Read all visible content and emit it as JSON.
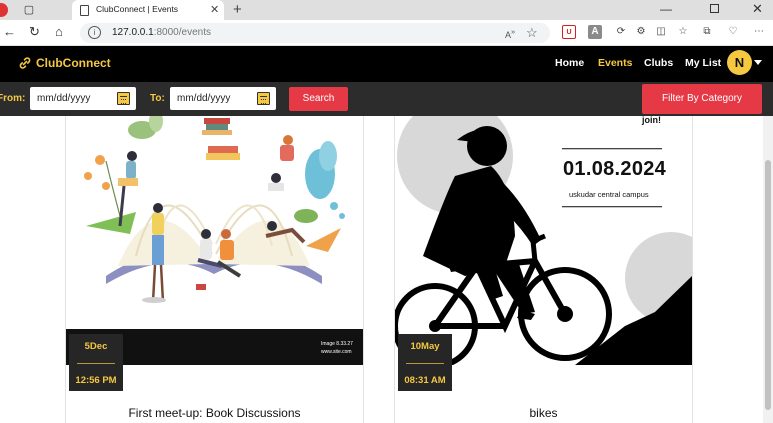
{
  "browser": {
    "tab_title": "ClubConnect | Events",
    "url_host": "127.0.0.1",
    "url_path": ":8000/events"
  },
  "navbar": {
    "brand": "ClubConnect",
    "links": [
      {
        "label": "Home",
        "active": false
      },
      {
        "label": "Events",
        "active": true
      },
      {
        "label": "Clubs",
        "active": false
      },
      {
        "label": "My List",
        "active": false
      }
    ],
    "avatar_initial": "N"
  },
  "filter": {
    "from_label": "From:",
    "from_value": "mm/dd/yyyy",
    "to_label": "To:",
    "to_value": "mm/dd/yyyy",
    "search_label": "Search",
    "category_label": "Filter By Category"
  },
  "events": [
    {
      "title": "First meet-up: Book Discussions",
      "day": "5Dec",
      "time": "12:56 PM",
      "image_caption_1": "Image 8.33.27",
      "image_caption_2": "www.site.com"
    },
    {
      "title": "bikes",
      "day": "10May",
      "time": "08:31 AM",
      "poster_join": "join!",
      "poster_date": "01.08.2024",
      "poster_place": "uskudar central campus"
    }
  ],
  "colors": {
    "accent_yellow": "#f5c842",
    "accent_red": "#e63946",
    "navbar_bg": "#000000",
    "filterbar_bg": "#2c2c2c"
  }
}
